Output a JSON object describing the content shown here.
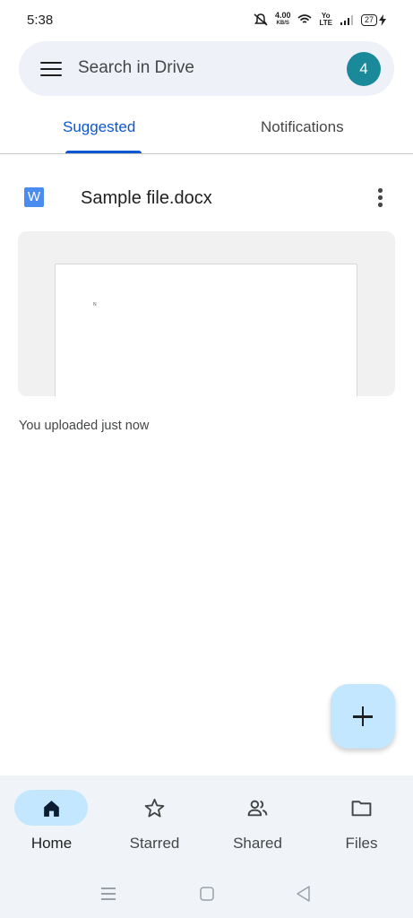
{
  "status_bar": {
    "time": "5:38",
    "net_speed_value": "4.00",
    "net_speed_unit": "KB/S",
    "volte_top": "Yo",
    "volte_bottom": "LTE",
    "battery": "27"
  },
  "search": {
    "placeholder": "Search in Drive",
    "avatar_letter": "4",
    "avatar_color": "#1a8a9a"
  },
  "tabs": {
    "suggested": "Suggested",
    "notifications": "Notifications",
    "active": "Suggested",
    "accent_color": "#0b57d0"
  },
  "file": {
    "type_icon": "W",
    "name": "Sample file.docx",
    "preview_mark": "N",
    "activity": "You uploaded just now"
  },
  "bottom_nav": {
    "items": [
      {
        "label": "Home",
        "icon": "home-icon",
        "active": true
      },
      {
        "label": "Starred",
        "icon": "star-icon",
        "active": false
      },
      {
        "label": "Shared",
        "icon": "people-icon",
        "active": false
      },
      {
        "label": "Files",
        "icon": "folder-icon",
        "active": false
      }
    ]
  }
}
